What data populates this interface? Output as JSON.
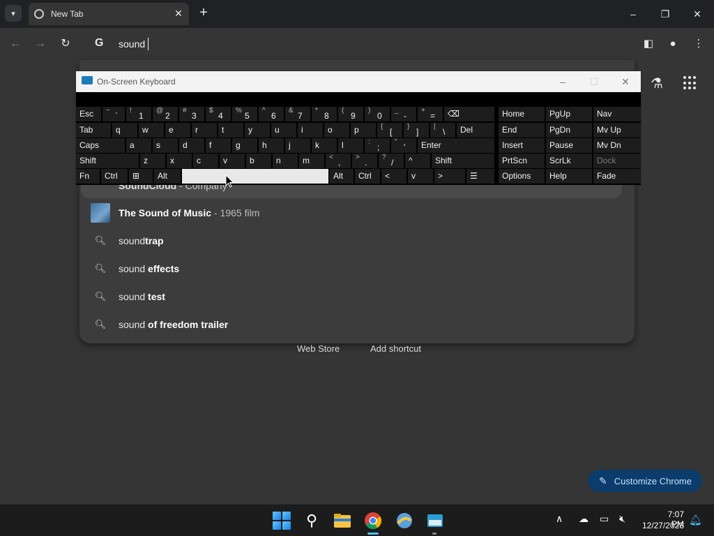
{
  "browser": {
    "tab_title": "New Tab",
    "omnibox_text": "sound",
    "search_engine_icon": "G"
  },
  "suggestions": {
    "highlighted": {
      "bold": "SoundCloud",
      "sub": "- Company"
    },
    "items": [
      {
        "type": "entity",
        "plain": "The ",
        "bold": "Sound of Music",
        "sub": "- 1965 film",
        "icon": "thumbnail"
      },
      {
        "type": "query",
        "plain": "sound",
        "bold": "trap",
        "icon": "search-icon"
      },
      {
        "type": "query",
        "plain": "sound ",
        "bold": "effects",
        "icon": "search-icon"
      },
      {
        "type": "query",
        "plain": "sound ",
        "bold": "test",
        "icon": "search-icon"
      },
      {
        "type": "query",
        "plain": "sound ",
        "bold": "of freedom trailer",
        "icon": "search-icon"
      }
    ]
  },
  "shortcuts": {
    "web_store": "Web Store",
    "add_shortcut": "Add shortcut"
  },
  "customize": {
    "label": "Customize Chrome"
  },
  "osk": {
    "title": "On-Screen Keyboard",
    "row1": [
      {
        "k": "Esc"
      },
      {
        "s": "~",
        "m": "`"
      },
      {
        "s": "!",
        "m": "1"
      },
      {
        "s": "@",
        "m": "2"
      },
      {
        "s": "#",
        "m": "3"
      },
      {
        "s": "$",
        "m": "4"
      },
      {
        "s": "%",
        "m": "5"
      },
      {
        "s": "^",
        "m": "6"
      },
      {
        "s": "&",
        "m": "7"
      },
      {
        "s": "*",
        "m": "8"
      },
      {
        "s": "(",
        "m": "9"
      },
      {
        "s": ")",
        "m": "0"
      },
      {
        "s": "_",
        "m": "-"
      },
      {
        "s": "+",
        "m": "="
      },
      {
        "k": "⌫"
      }
    ],
    "row2": [
      {
        "k": "Tab"
      },
      {
        "k": "q"
      },
      {
        "k": "w"
      },
      {
        "k": "e"
      },
      {
        "k": "r"
      },
      {
        "k": "t"
      },
      {
        "k": "y"
      },
      {
        "k": "u"
      },
      {
        "k": "i"
      },
      {
        "k": "o"
      },
      {
        "k": "p"
      },
      {
        "s": "{",
        "m": "["
      },
      {
        "s": "}",
        "m": "]"
      },
      {
        "s": "|",
        "m": "\\"
      },
      {
        "k": "Del"
      }
    ],
    "row3": [
      {
        "k": "Caps"
      },
      {
        "k": "a"
      },
      {
        "k": "s"
      },
      {
        "k": "d"
      },
      {
        "k": "f"
      },
      {
        "k": "g"
      },
      {
        "k": "h"
      },
      {
        "k": "j"
      },
      {
        "k": "k"
      },
      {
        "k": "l"
      },
      {
        "s": ":",
        "m": ";"
      },
      {
        "s": "\"",
        "m": "'"
      },
      {
        "k": "Enter"
      }
    ],
    "row4": [
      {
        "k": "Shift"
      },
      {
        "k": "z"
      },
      {
        "k": "x"
      },
      {
        "k": "c"
      },
      {
        "k": "v"
      },
      {
        "k": "b"
      },
      {
        "k": "n"
      },
      {
        "k": "m"
      },
      {
        "s": "<",
        "m": ","
      },
      {
        "s": ">",
        "m": "."
      },
      {
        "s": "?",
        "m": "/"
      },
      {
        "k": "^"
      },
      {
        "k": "Shift"
      }
    ],
    "row5": [
      {
        "k": "Fn"
      },
      {
        "k": "Ctrl"
      },
      {
        "k": "⊞"
      },
      {
        "k": "Alt"
      },
      {
        "k": ""
      },
      {
        "k": "Alt"
      },
      {
        "k": "Ctrl"
      },
      {
        "k": "<"
      },
      {
        "k": "v"
      },
      {
        "k": ">"
      },
      {
        "k": "☰"
      }
    ],
    "nav": [
      [
        "Home",
        "PgUp",
        "Nav"
      ],
      [
        "End",
        "PgDn",
        "Mv Up"
      ],
      [
        "Insert",
        "Pause",
        "Mv Dn"
      ],
      [
        "PrtScn",
        "ScrLk",
        "Dock"
      ],
      [
        "Options",
        "Help",
        "Fade"
      ]
    ]
  },
  "taskbar": {
    "time": "7:07 PM",
    "date": "12/27/2023"
  }
}
